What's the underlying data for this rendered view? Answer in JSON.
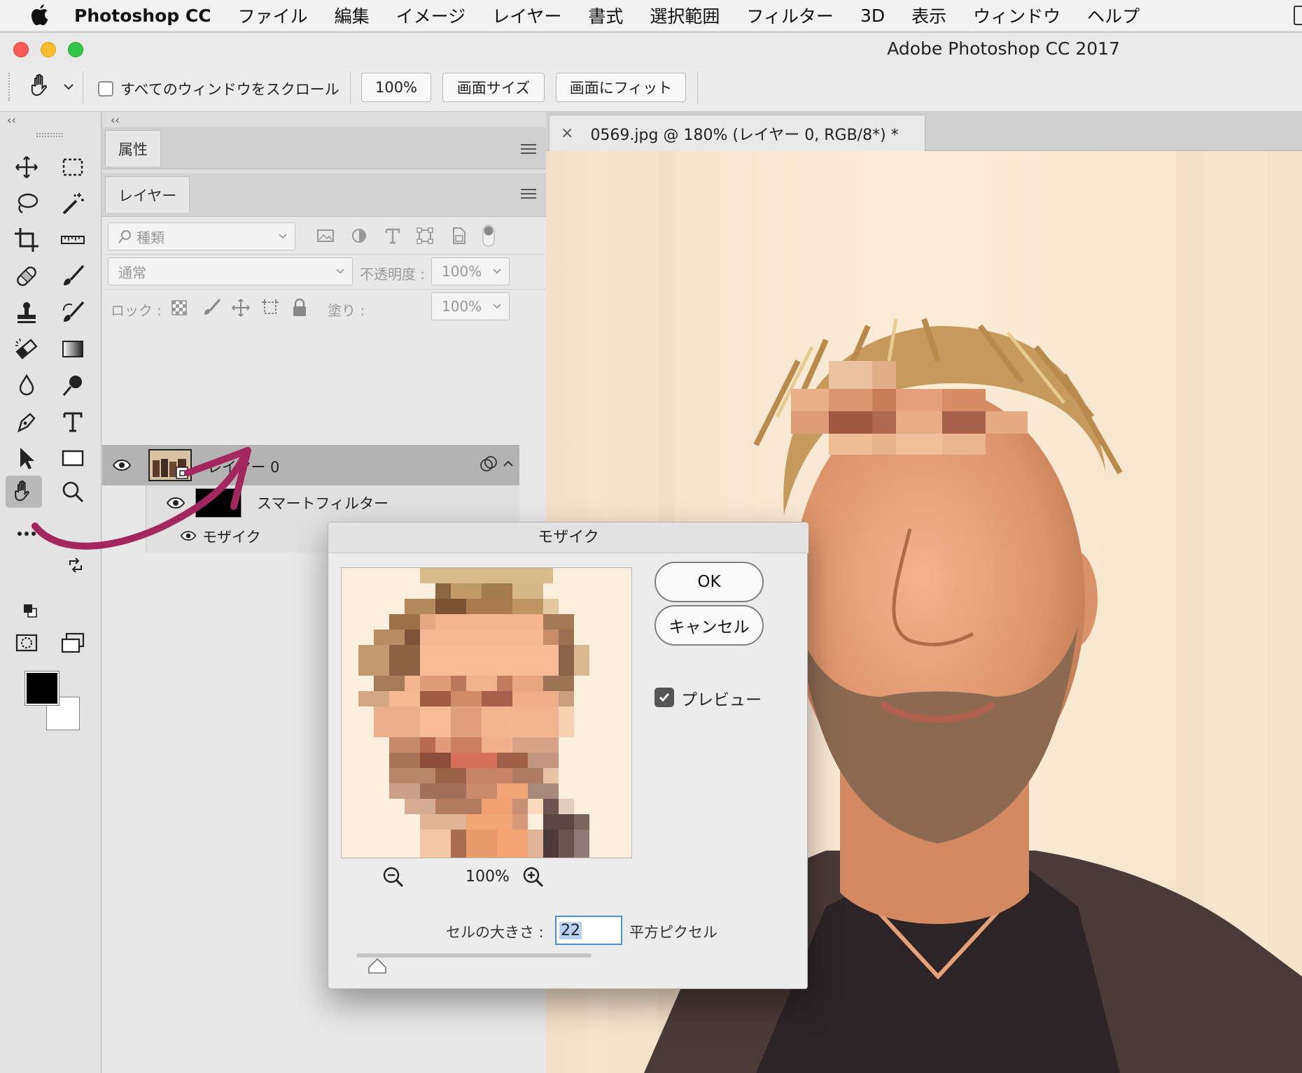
{
  "menubar": {
    "app_name": "Photoshop CC",
    "items": [
      "ファイル",
      "編集",
      "イメージ",
      "レイヤー",
      "書式",
      "選択範囲",
      "フィルター",
      "3D",
      "表示",
      "ウィンドウ",
      "ヘルプ"
    ]
  },
  "window": {
    "title": "Adobe Photoshop CC 2017"
  },
  "options": {
    "scroll_all_label": "すべてのウィンドウをスクロール",
    "zoom_100": "100%",
    "fit_screen": "画面サイズ",
    "fill_screen": "画面にフィット"
  },
  "panels": {
    "collapse": "‹‹",
    "properties_tab": "属性",
    "layers_tab": "レイヤー",
    "filter_kind": "種類",
    "blend_mode": "通常",
    "opacity_label": "不透明度 :",
    "opacity_value": "100%",
    "lock_label": "ロック :",
    "fill_label": "塗り :",
    "fill_value": "100%",
    "layers": [
      {
        "name": "レイヤー 0",
        "selected": true
      }
    ],
    "smart_filter_label": "スマートフィルター",
    "filter_name": "モザイク"
  },
  "document": {
    "tab_close": "×",
    "tab_title": "0569.jpg @ 180% (レイヤー 0, RGB/8*) *"
  },
  "dialog": {
    "title": "モザイク",
    "ok": "OK",
    "cancel": "キャンセル",
    "preview_label": "プレビュー",
    "preview_checked": true,
    "zoom": "100%",
    "cell_size_label": "セルの大きさ :",
    "cell_size_value": "22",
    "cell_size_unit": "平方ピクセル"
  },
  "colors": {
    "arrow": "#a3275c",
    "accent_blue": "#4d8ee8"
  }
}
